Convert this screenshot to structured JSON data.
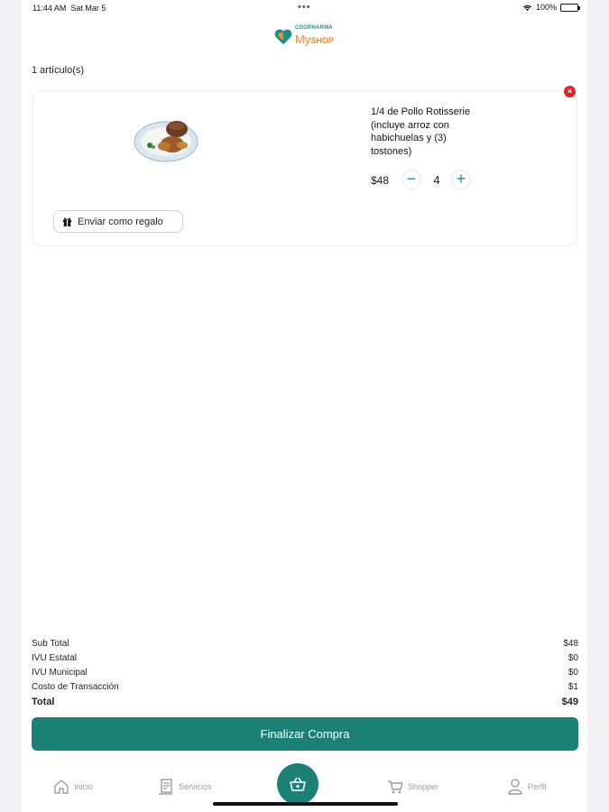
{
  "status_bar": {
    "time": "11:44 AM",
    "date": "Sat Mar 5",
    "dots": "•••",
    "battery_text": "100%"
  },
  "logo": {
    "top_text": "COOPHARMA",
    "main_text": "My",
    "main_suffix": "SHOP",
    "colors": {
      "teal": "#1a8f8a",
      "orange": "#f08a2c"
    }
  },
  "cart": {
    "item_count": "1 artículo(s)",
    "items": [
      {
        "name": "1/4 de Pollo Rotisserie (incluye arroz con habichuelas y (3) tostones)",
        "price": "$48",
        "quantity": "4",
        "gift_label": "Enviar como regalo"
      }
    ]
  },
  "summary": {
    "subtotal_label": "Sub Total",
    "subtotal_value": "$48",
    "ivu_estatal_label": "IVU Estatal",
    "ivu_estatal_value": "$0",
    "ivu_municipal_label": "IVU Municipal",
    "ivu_municipal_value": "$0",
    "costo_label": "Costo de Transacción",
    "costo_value": "$1",
    "total_label": "Total",
    "total_value": "$49"
  },
  "checkout_label": "Finalizar Compra",
  "bottom_nav": {
    "items": [
      {
        "label": "Inicio",
        "icon": "home-icon"
      },
      {
        "label": "Servicios",
        "icon": "services-icon"
      },
      {
        "label": "",
        "icon": "basket-icon"
      },
      {
        "label": "Shopper",
        "icon": "cart-icon"
      },
      {
        "label": "Perfil",
        "icon": "person-icon"
      }
    ]
  },
  "colors": {
    "accent": "#1b8177",
    "remove": "#e0222b"
  }
}
